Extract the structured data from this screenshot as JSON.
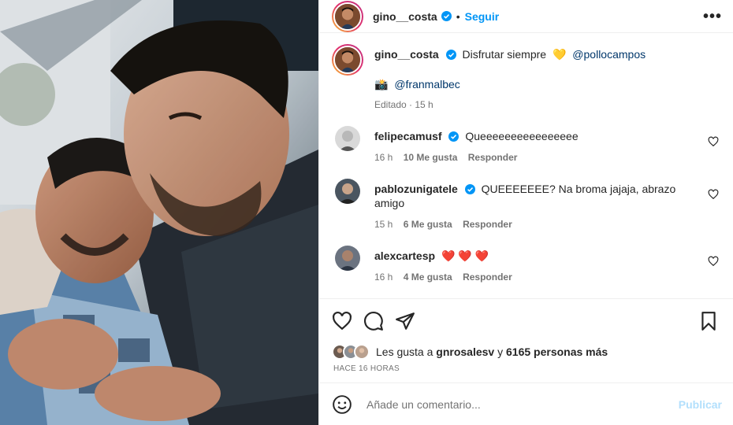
{
  "header": {
    "username": "gino__costa",
    "separator": "•",
    "follow_label": "Seguir",
    "more_label": "•••"
  },
  "caption": {
    "username": "gino__costa",
    "text": "Disfrutar siempre",
    "emoji": "💛",
    "mention": "@pollocampos",
    "credit_emoji": "📸",
    "credit_mention": "@franmalbec",
    "edited": "Editado · 15 h"
  },
  "comments": [
    {
      "username": "felipecamusf",
      "verified": true,
      "text": "Queeeeeeeeeeeeeeee",
      "time": "16 h",
      "likes": "10 Me gusta",
      "reply": "Responder"
    },
    {
      "username": "pablozunigatele",
      "verified": true,
      "text": "QUEEEEEEE? Na broma jajaja, abrazo amigo",
      "time": "15 h",
      "likes": "6 Me gusta",
      "reply": "Responder"
    },
    {
      "username": "alexcartesp",
      "verified": false,
      "text": "❤️ ❤️ ❤️",
      "time": "16 h",
      "likes": "4 Me gusta",
      "reply": "Responder"
    }
  ],
  "likes": {
    "prefix": "Les gusta a",
    "user": "gnrosalesv",
    "connector": "y",
    "count": "6165 personas más"
  },
  "timestamp": "HACE 16 HORAS",
  "add_comment": {
    "placeholder": "Añade un comentario...",
    "publish_label": "Publicar"
  },
  "colors": {
    "accent": "#0095f6",
    "publish_disabled": "#b2dffc",
    "heart_red": "#ed4956",
    "verified": "#0095f6"
  },
  "icons": [
    "heart-icon",
    "comment-icon",
    "share-icon",
    "save-icon",
    "emoji-icon",
    "verified-icon"
  ]
}
